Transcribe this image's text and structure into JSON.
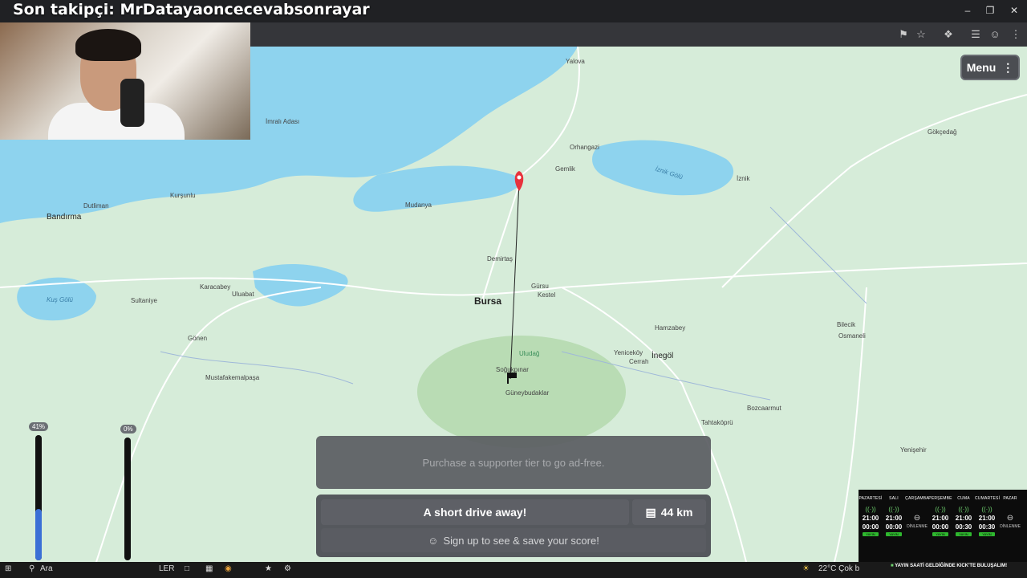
{
  "overlay": {
    "title": "Son takipçi: MrDatayaoncecevabsonrayar"
  },
  "window": {
    "minimize_icon": "minimize-icon",
    "restore_icon": "restore-icon",
    "close_icon": "close-icon"
  },
  "toolbar": {
    "icons": [
      "translate-icon",
      "star-icon",
      "extensions-icon",
      "media-icon",
      "profile-icon",
      "kebab-icon"
    ]
  },
  "menu": {
    "label": "Menu",
    "icon": "kebab-icon"
  },
  "map": {
    "labels": {
      "bursa": "Bursa",
      "inegol": "İnegöl",
      "bandirma": "Bandırma",
      "gemlik": "Gemlik",
      "mudanya": "Mudanya",
      "yalova": "Yalova",
      "iznik": "İznik",
      "iznik_golu": "İznik Gölü",
      "kus_golu": "Kuş Gölü",
      "uludag": "Uludağ",
      "orhangazi": "Orhangazi",
      "gursu": "Gürsu",
      "kestel": "Kestel",
      "karacabey": "Karacabey",
      "mustafakemalpasa": "Mustafakemalpaşa",
      "gonen": "Gönen",
      "bilecik": "Bilecik",
      "yenisehir": "Yenişehir",
      "guneybudaklar": "Güneybudaklar",
      "sogukpinar": "Soğukpınar",
      "imrali": "İmralı Adası",
      "ulubat": "Uluabat",
      "osmaneli": "Osmaneli",
      "gokcedag": "Gökçedağ",
      "demirtas": "Demirtaş",
      "kursunlu": "Kurşunlu",
      "bozuyuk": "Bozcaarmut",
      "tahtakopru": "Tahtaköprü",
      "hamzabey": "Hamzabey",
      "yenice": "Yeniceköy",
      "cerrah": "Cerrah",
      "dutliman": "Dutliman",
      "sultaniye": "Sultaniye"
    }
  },
  "result": {
    "ad_text": "Purchase a supporter tier to go ad-free.",
    "message": "A short drive away!",
    "distance": "44 km",
    "distance_icon": "ruler-icon",
    "signup_text": "Sign up to see & save your score!",
    "signup_icon": "user-circle-icon"
  },
  "bars": {
    "left_percent": "41%",
    "left_fill": 0.41,
    "right_percent": "0%",
    "right_fill": 0.0
  },
  "schedule": {
    "days": [
      {
        "name": "PAZARTESİ",
        "start": "21:00",
        "end": "00:00",
        "tag": "YAYIN"
      },
      {
        "name": "SALI",
        "start": "21:00",
        "end": "00:00",
        "tag": "YAYIN"
      },
      {
        "name": "ÇARŞAMBA",
        "off": "DİNLENME"
      },
      {
        "name": "PERŞEMBE",
        "start": "21:00",
        "end": "00:00",
        "tag": "YAYIN"
      },
      {
        "name": "CUMA",
        "start": "21:00",
        "end": "00:30",
        "tag": "YAYIN"
      },
      {
        "name": "CUMARTESİ",
        "start": "21:00",
        "end": "00:30",
        "tag": "YAYIN"
      },
      {
        "name": "PAZAR",
        "off": "DİNLENME"
      }
    ],
    "banner": "YAYIN SAATİ GELDİĞİNDE KICK'TE BULUŞALIM!"
  },
  "taskbar": {
    "search": "Ara",
    "weather": "22°C  Çok b",
    "app_text": "LER"
  },
  "colors": {
    "map_bg": "#d6ecd9",
    "water": "#8ed3ee",
    "pin": "#e8323c",
    "bar_fill": "#3b6fd6"
  }
}
